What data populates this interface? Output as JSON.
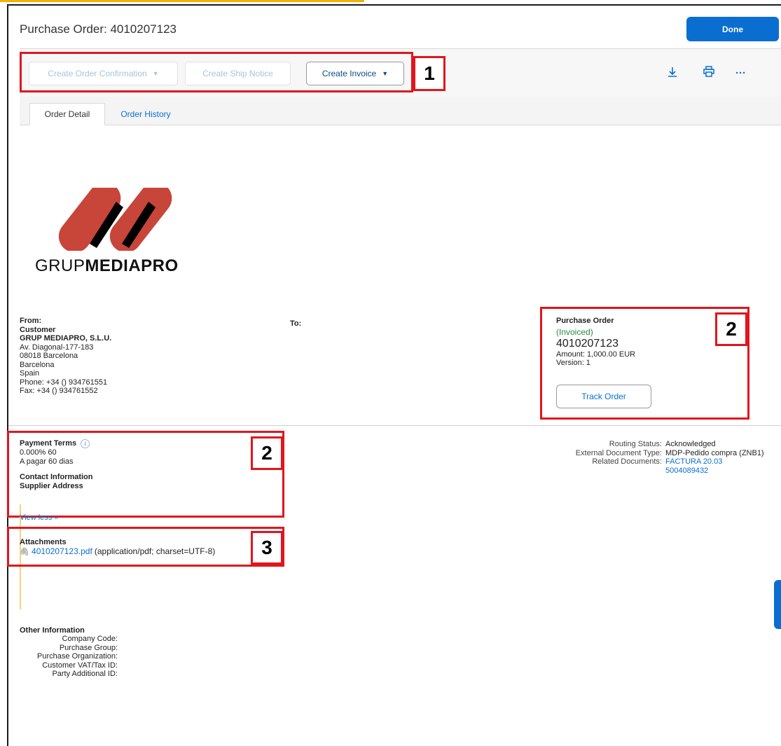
{
  "header": {
    "title": "Purchase Order: 4010207123",
    "done_label": "Done"
  },
  "toolbar": {
    "create_order_confirmation": "Create Order Confirmation",
    "create_ship_notice": "Create Ship Notice",
    "create_invoice": "Create Invoice",
    "icons": [
      "download-icon",
      "print-icon",
      "more-icon"
    ]
  },
  "tabs": [
    {
      "label": "Order Detail",
      "active": true
    },
    {
      "label": "Order History",
      "active": false
    }
  ],
  "logo": {
    "text_light": "GRUP",
    "text_bold": "MEDIAPRO"
  },
  "from": {
    "label": "From:",
    "role": "Customer",
    "company": "GRUP MEDIAPRO, S.L.U.",
    "lines": [
      "Av. Diagonal-177-183",
      "08018 Barcelona",
      "Barcelona",
      "Spain",
      "Phone:  +34 () 934761551",
      "Fax:  +34 () 934761552"
    ]
  },
  "to": {
    "label": "To:"
  },
  "po_summary": {
    "heading": "Purchase Order",
    "status": "(Invoiced)",
    "number": "4010207123",
    "amount": "Amount: 1,000.00 EUR",
    "version": "Version: 1",
    "track_label": "Track Order"
  },
  "payment": {
    "title": "Payment Terms",
    "line1": "0.000% 60",
    "line2": "A pagar 60 dias",
    "contact_title": "Contact Information",
    "supplier_title": "Supplier Address"
  },
  "other_info": {
    "title": "Other Information",
    "fields": [
      "Company Code:",
      "Purchase Group:",
      "Purchase Organization:",
      "Customer VAT/Tax ID:",
      "Party Additional ID:"
    ],
    "view_less": "View less »"
  },
  "routing": {
    "labels": [
      "Routing Status:",
      "External Document Type:",
      "Related Documents:"
    ],
    "routing_status": "Acknowledged",
    "doc_type": "MDP-Pedido compra (ZNB1)",
    "related": [
      "FACTURA 20.03",
      "5004089432"
    ]
  },
  "attachments": {
    "title": "Attachments",
    "file": "4010207123.pdf",
    "mime": "(application/pdf; charset=UTF-8)"
  },
  "callouts": [
    "1",
    "2",
    "2",
    "3"
  ],
  "colors": {
    "accent": "#0a6ed1",
    "callout": "#e0161d",
    "logo": "#c8453a",
    "status": "#2b8a3e"
  }
}
